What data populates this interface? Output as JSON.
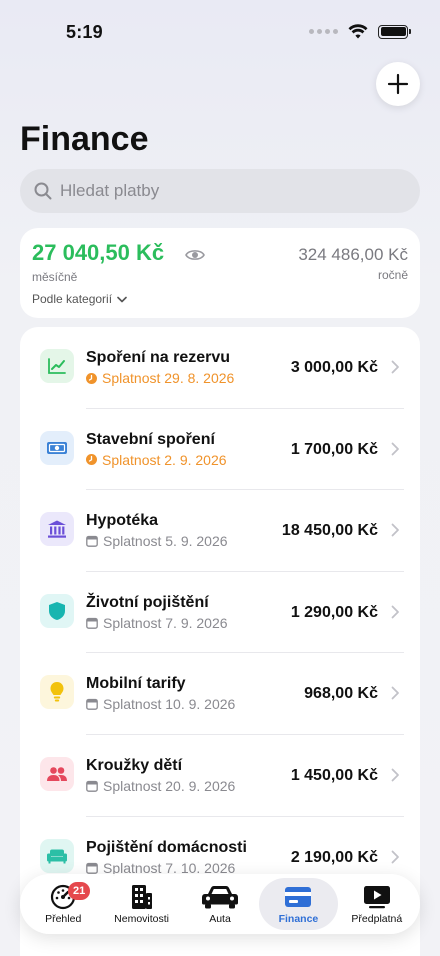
{
  "status": {
    "time": "5:19"
  },
  "page": {
    "title": "Finance"
  },
  "search": {
    "placeholder": "Hledat platby"
  },
  "summary": {
    "monthly_amount": "27 040,50 Kč",
    "monthly_label": "měsíčně",
    "yearly_amount": "324 486,00 Kč",
    "yearly_label": "ročně",
    "filter_label": "Podle kategorií"
  },
  "payments": [
    {
      "title": "Spoření na rezervu",
      "due": "Splatnost 29. 8. 2026",
      "amount": "3 000,00 Kč",
      "due_state": "warning",
      "icon": "chart-up-icon",
      "icon_bg": "#e4f6e8",
      "icon_color": "#2bbd5c"
    },
    {
      "title": "Stavební spoření",
      "due": "Splatnost 2. 9. 2026",
      "amount": "1 700,00 Kč",
      "due_state": "warning",
      "icon": "banknote-icon",
      "icon_bg": "#e3eefb",
      "icon_color": "#3b82d6"
    },
    {
      "title": "Hypotéka",
      "due": "Splatnost 5. 9. 2026",
      "amount": "18 450,00 Kč",
      "due_state": "normal",
      "icon": "bank-icon",
      "icon_bg": "#ebe8fb",
      "icon_color": "#6b4fd8"
    },
    {
      "title": "Životní pojištění",
      "due": "Splatnost 7. 9. 2026",
      "amount": "1 290,00 Kč",
      "due_state": "normal",
      "icon": "shield-icon",
      "icon_bg": "#e0f6f5",
      "icon_color": "#18b5b0"
    },
    {
      "title": "Mobilní tarify",
      "due": "Splatnost 10. 9. 2026",
      "amount": "968,00 Kč",
      "due_state": "normal",
      "icon": "lightbulb-icon",
      "icon_bg": "#fdf6dc",
      "icon_color": "#f2c20c"
    },
    {
      "title": "Kroužky dětí",
      "due": "Splatnost 20. 9. 2026",
      "amount": "1 450,00 Kč",
      "due_state": "normal",
      "icon": "people-icon",
      "icon_bg": "#fde6ea",
      "icon_color": "#e5485d"
    },
    {
      "title": "Pojištění domácnosti",
      "due": "Splatnost 7. 10. 2026",
      "amount": "2 190,00 Kč",
      "due_state": "normal",
      "icon": "sofa-icon",
      "icon_bg": "#e0f6f2",
      "icon_color": "#2bbfa6"
    }
  ],
  "tabs": [
    {
      "label": "Přehled",
      "icon": "speedometer-icon",
      "badge": "21",
      "active": false
    },
    {
      "label": "Nemovitosti",
      "icon": "building-icon",
      "active": false
    },
    {
      "label": "Auta",
      "icon": "car-icon",
      "active": false
    },
    {
      "label": "Finance",
      "icon": "credit-card-icon",
      "active": true
    },
    {
      "label": "Předplatná",
      "icon": "play-screen-icon",
      "active": false
    }
  ],
  "colors": {
    "accent": "#2f6fd6",
    "positive": "#2bbd5c",
    "warning": "#f0932b",
    "badge": "#e5484d"
  }
}
